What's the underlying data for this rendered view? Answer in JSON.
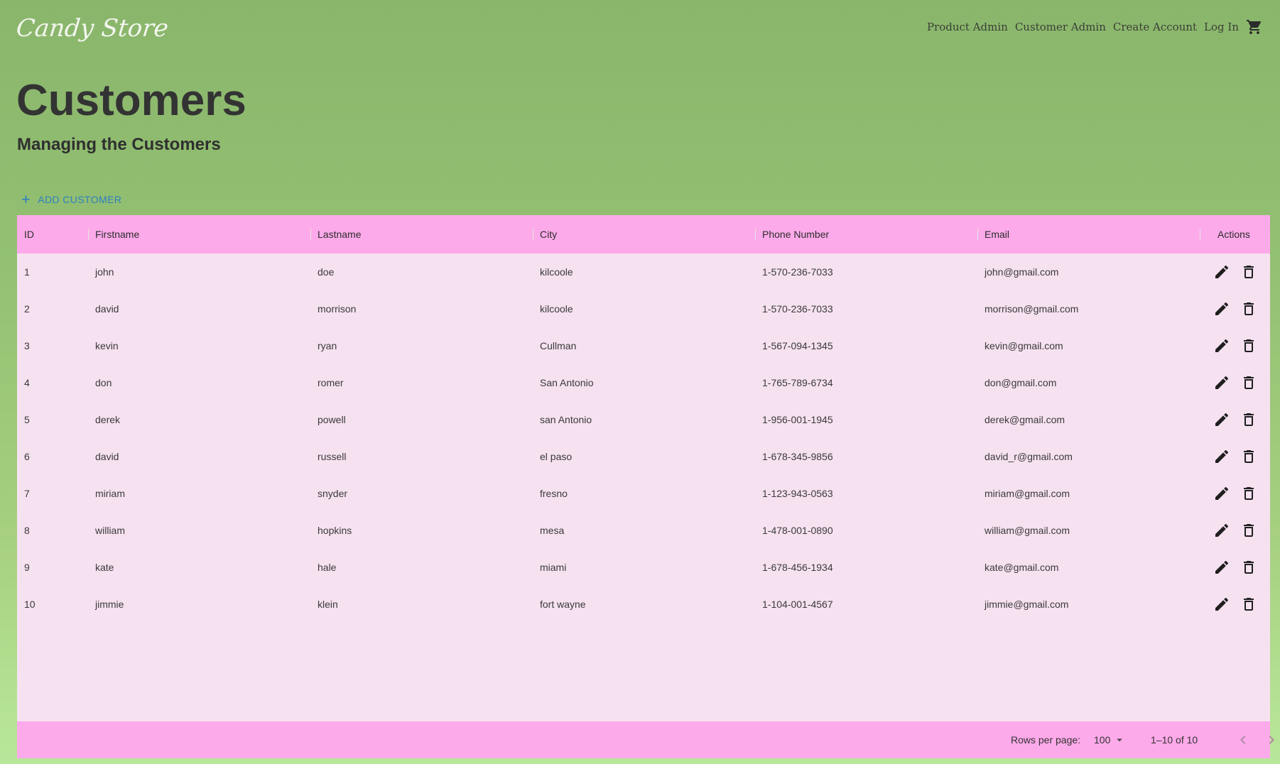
{
  "nav": {
    "logo": "Candy Store",
    "links": [
      "Product Admin",
      "Customer Admin",
      "Create Account",
      "Log In"
    ],
    "cart_icon": "shopping-cart-icon"
  },
  "page": {
    "title": "Customers",
    "subtitle": "Managing the Customers"
  },
  "toolbar": {
    "add_icon": "plus-icon",
    "add_label": "ADD CUSTOMER"
  },
  "table": {
    "columns": [
      "ID",
      "Firstname",
      "Lastname",
      "City",
      "Phone Number",
      "Email",
      "Actions"
    ],
    "rows": [
      [
        "1",
        "john",
        "doe",
        "kilcoole",
        "1-570-236-7033",
        "john@gmail.com"
      ],
      [
        "2",
        "david",
        "morrison",
        "kilcoole",
        "1-570-236-7033",
        "morrison@gmail.com"
      ],
      [
        "3",
        "kevin",
        "ryan",
        "Cullman",
        "1-567-094-1345",
        "kevin@gmail.com"
      ],
      [
        "4",
        "don",
        "romer",
        "San Antonio",
        "1-765-789-6734",
        "don@gmail.com"
      ],
      [
        "5",
        "derek",
        "powell",
        "san Antonio",
        "1-956-001-1945",
        "derek@gmail.com"
      ],
      [
        "6",
        "david",
        "russell",
        "el paso",
        "1-678-345-9856",
        "david_r@gmail.com"
      ],
      [
        "7",
        "miriam",
        "snyder",
        "fresno",
        "1-123-943-0563",
        "miriam@gmail.com"
      ],
      [
        "8",
        "william",
        "hopkins",
        "mesa",
        "1-478-001-0890",
        "william@gmail.com"
      ],
      [
        "9",
        "kate",
        "hale",
        "miami",
        "1-678-456-1934",
        "kate@gmail.com"
      ],
      [
        "10",
        "jimmie",
        "klein",
        "fort wayne",
        "1-104-001-4567",
        "jimmie@gmail.com"
      ]
    ],
    "action_icons": [
      "edit-pencil-icon",
      "delete-trash-icon"
    ]
  },
  "pagination": {
    "rows_per_page_label": "Rows per page:",
    "rows_per_page_value": "100",
    "range_text": "1–10 of 10"
  },
  "colors": {
    "header_bg": "#fdaaea",
    "grid_bg": "#f6e1f1",
    "accent": "#2f7fc1",
    "page_bg_top": "#8ab66c",
    "page_bg_bottom": "#b9e79a"
  }
}
